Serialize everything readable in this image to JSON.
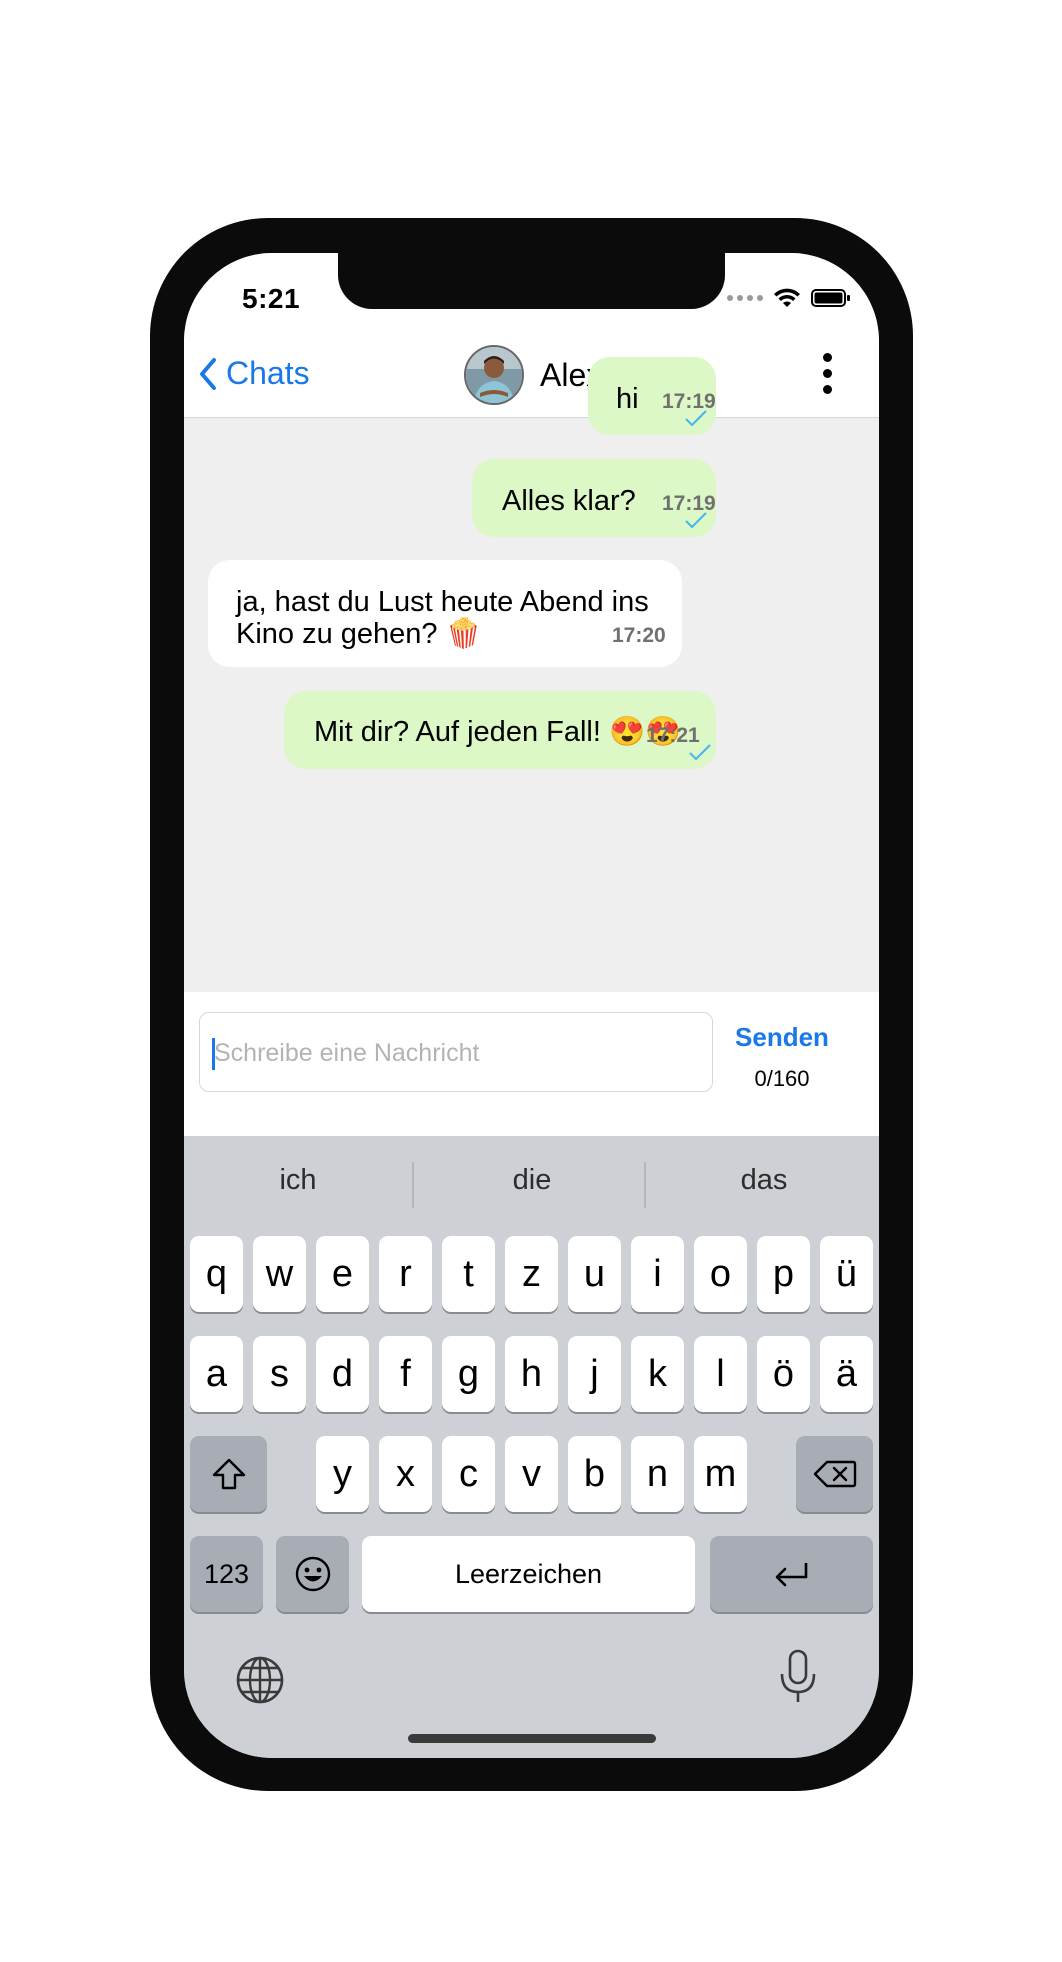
{
  "status_bar": {
    "time": "5:21"
  },
  "nav": {
    "back_label": "Chats",
    "contact_name": "Alex"
  },
  "messages": [
    {
      "direction": "outgoing",
      "text": "hi",
      "time": "17:19",
      "status": "sent"
    },
    {
      "direction": "outgoing",
      "text": "Alles klar?",
      "time": "17:19",
      "status": "sent"
    },
    {
      "direction": "incoming",
      "line1": "ja, hast du Lust heute Abend ins",
      "line2": "Kino zu gehen? 🍿",
      "time": "17:20"
    },
    {
      "direction": "outgoing",
      "text": "Mit dir? Auf jeden Fall! 😍😍",
      "time": "17:21",
      "status": "sent"
    }
  ],
  "composer": {
    "placeholder": "Schreibe eine Nachricht",
    "send_label": "Senden",
    "counter": "0/160"
  },
  "keyboard": {
    "suggestions": [
      "ich",
      "die",
      "das"
    ],
    "row1": [
      "q",
      "w",
      "e",
      "r",
      "t",
      "z",
      "u",
      "i",
      "o",
      "p",
      "ü"
    ],
    "row2": [
      "a",
      "s",
      "d",
      "f",
      "g",
      "h",
      "j",
      "k",
      "l",
      "ö",
      "ä"
    ],
    "row3": [
      "y",
      "x",
      "c",
      "v",
      "b",
      "n",
      "m"
    ],
    "numbers_label": "123",
    "space_label": "Leerzeichen",
    "icons": [
      "shift-icon",
      "backspace-icon",
      "emoji-icon",
      "return-icon",
      "globe-icon",
      "microphone-icon"
    ]
  },
  "colors": {
    "accent": "#1b78e8",
    "outgoing_bubble": "#dcf8c6",
    "incoming_bubble": "#ffffff",
    "check": "#45b3f0"
  }
}
